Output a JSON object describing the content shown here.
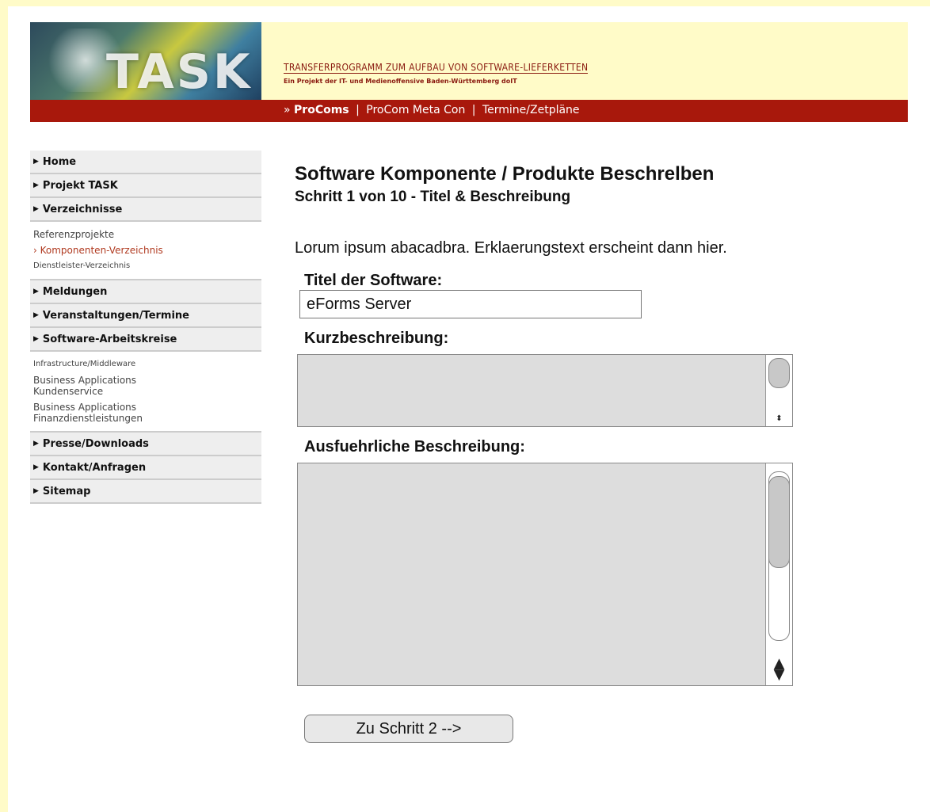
{
  "header": {
    "logo_text": "TASK",
    "banner_title": "TRANSFERPROGRAMM ZUM AUFBAU VON SOFTWARE-LIEFERKETTEN",
    "banner_subtitle": "Ein Projekt der IT- und Medienoffensive Baden-Württemberg doIT",
    "nav_prefix": "»",
    "nav_active": "ProComs",
    "nav_links": [
      "ProCom Meta Con",
      "Termine/Zetpläne"
    ],
    "nav_separator": "|"
  },
  "sidebar": {
    "items": [
      {
        "label": "Home"
      },
      {
        "label": "Projekt TASK"
      },
      {
        "label": "Verzeichnisse",
        "sub": [
          "Referenzprojekte",
          "Komponenten-Verzeichnis",
          "Dienstleister-Verzeichnis"
        ]
      },
      {
        "label": "Meldungen"
      },
      {
        "label": "Veranstaltungen/Termine"
      },
      {
        "label": "Software-Arbeitskreise",
        "sub": [
          "Infrastructure/Middleware",
          "Business Applications Kundenservice",
          "Business Applications Finanzdienstleistungen"
        ]
      },
      {
        "label": "Presse/Downloads"
      },
      {
        "label": "Kontakt/Anfragen"
      },
      {
        "label": "Sitemap"
      }
    ],
    "active_sub": "Komponenten-Verzeichnis"
  },
  "content": {
    "title": "Software Komponente / Produkte Beschrelben",
    "step": "Schritt 1 von 10 - Titel & Beschreibung",
    "intro": "Lorum ipsum abacadbra. Erklaerungstext erscheint dann hier.",
    "title_label": "Titel der Software:",
    "title_value": "eForms Server",
    "short_label": "Kurzbeschreibung:",
    "long_label": "Ausfuehrliche Beschreibung:",
    "next_button": "Zu Schritt 2 -->"
  },
  "colors": {
    "page_background": "#fffbc8",
    "nav_bar": "#a8180c",
    "banner_text": "#8a1a10",
    "textarea_bg": "#dddddd"
  },
  "icons": [
    "triangle-right-icon",
    "scroll-arrows-icon"
  ]
}
